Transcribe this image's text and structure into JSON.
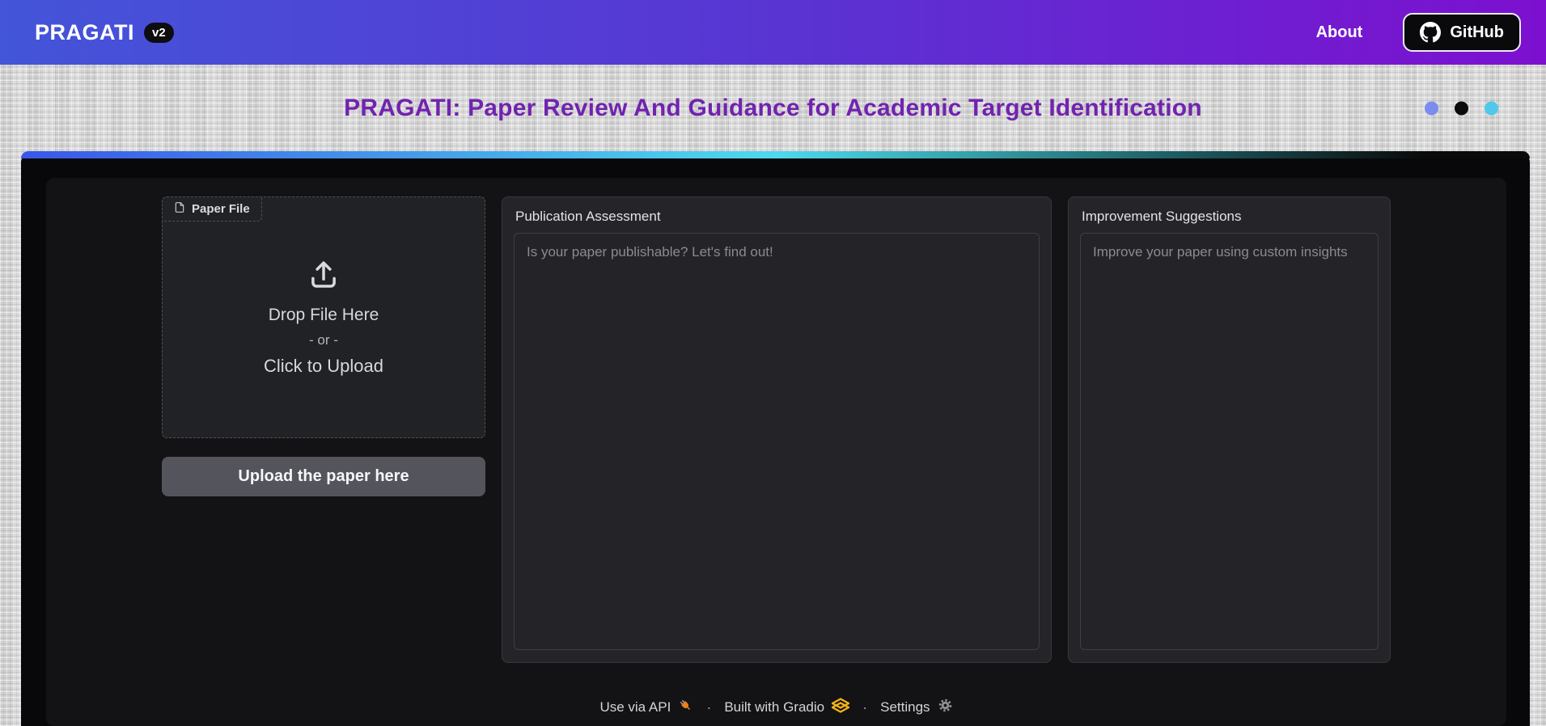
{
  "navbar": {
    "brand": "PRAGATI",
    "version_badge": "v2",
    "about_label": "About",
    "github_label": "GitHub"
  },
  "header": {
    "title": "PRAGATI: Paper Review And Guidance for Academic Target Identification",
    "title_color": "#7123af",
    "dots": [
      {
        "name": "dot-blue",
        "color": "#7b8bf0"
      },
      {
        "name": "dot-black",
        "color": "#0a0a0a"
      },
      {
        "name": "dot-cyan",
        "color": "#4fc8ec"
      }
    ]
  },
  "upload": {
    "label": "Paper File",
    "drop_text": "Drop File Here",
    "or_text": "- or -",
    "click_text": "Click to Upload",
    "button_label": "Upload the paper here"
  },
  "panels": {
    "assessment": {
      "label": "Publication Assessment",
      "placeholder": "Is your paper publishable? Let's find out!"
    },
    "suggestions": {
      "label": "Improvement Suggestions",
      "placeholder": "Improve your paper using custom insights"
    }
  },
  "footer": {
    "api_label": "Use via API",
    "sep1": "·",
    "gradio_label": "Built with Gradio",
    "sep2": "·",
    "settings_label": "Settings"
  },
  "colors": {
    "navbar_gradient_left": "#4355d9",
    "navbar_gradient_right": "#7d10d0",
    "card_topbar_blue": "#3a57e8",
    "card_topbar_cyan": "#4ed9ee",
    "card_background": "#08080a",
    "panel_background": "#242429",
    "upload_button_background": "#54545c",
    "gradio_logo_gold": "#f3b316",
    "plug_icon_orange": "#e8821e"
  }
}
